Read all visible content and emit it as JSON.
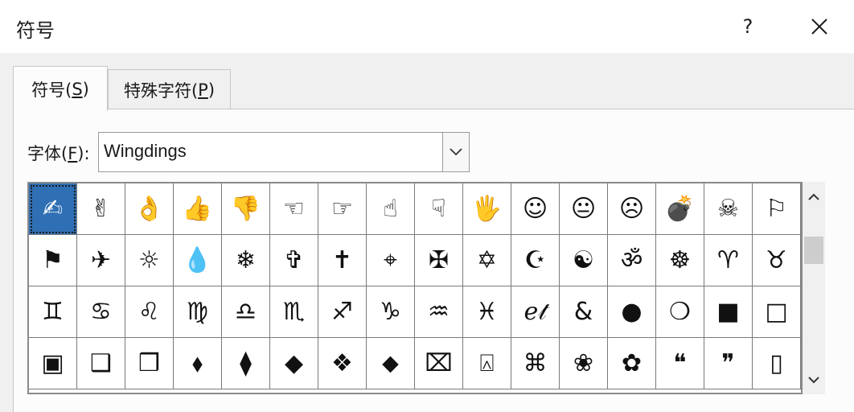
{
  "dialog": {
    "title": "符号",
    "help_label": "?",
    "icons": {
      "close": "close-icon",
      "dropdown": "chevron-down-icon",
      "scroll_up": "chevron-up-icon",
      "scroll_down": "chevron-down-icon"
    }
  },
  "tabs": [
    {
      "label_pre": "符号(",
      "accel": "S",
      "label_post": ")",
      "active": true
    },
    {
      "label_pre": "特殊字符(",
      "accel": "P",
      "label_post": ")",
      "active": false
    }
  ],
  "font": {
    "label_pre": "字体(",
    "accel": "F",
    "label_post": "):",
    "value": "Wingdings"
  },
  "symbols": [
    "✍",
    "✌",
    "👌",
    "👍",
    "👎",
    "☜",
    "☞",
    "☝",
    "☟",
    "🖐",
    "☺",
    "😐",
    "☹",
    "💣",
    "☠",
    "⚐",
    "⚑",
    "✈",
    "☼",
    "💧",
    "❄",
    "✞",
    "✝",
    "⌖",
    "✠",
    "✡",
    "☪",
    "☯",
    "ॐ",
    "☸",
    "♈",
    "♉",
    "♊",
    "♋",
    "♌",
    "♍",
    "♎",
    "♏",
    "♐",
    "♑",
    "♒",
    "♓",
    "ℯ𝓉",
    "&",
    "●",
    "❍",
    "■",
    "□",
    "▣",
    "❑",
    "❒",
    "⬧",
    "⧫",
    "◆",
    "❖",
    "⬥",
    "⌧",
    "⍓",
    "⌘",
    "❀",
    "✿",
    "❝",
    "❞",
    "▯"
  ],
  "selected_index": 0,
  "scroll": {
    "position_fraction": 0.2
  },
  "colors": {
    "selection": "#2f6fb3",
    "titlebar": "#ffffff",
    "background": "#f0f0f0"
  }
}
